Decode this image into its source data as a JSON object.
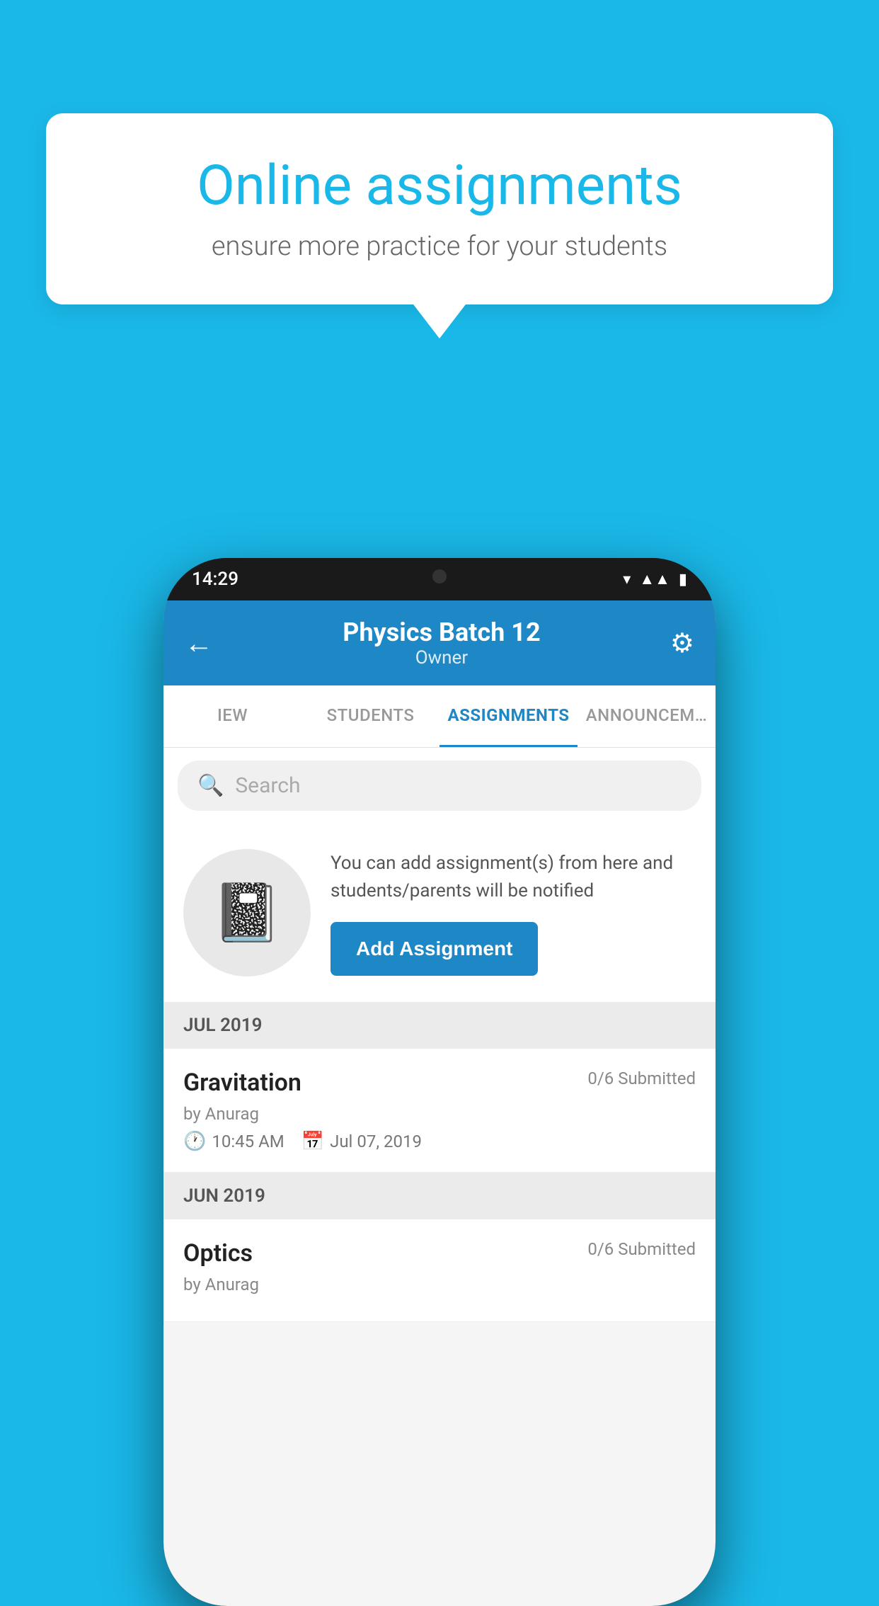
{
  "background_color": "#1ab8e8",
  "speech_bubble": {
    "title": "Online assignments",
    "subtitle": "ensure more practice for your students"
  },
  "status_bar": {
    "time": "14:29",
    "icons": [
      "wifi",
      "signal",
      "battery"
    ]
  },
  "header": {
    "back_label": "←",
    "title": "Physics Batch 12",
    "subtitle": "Owner",
    "settings_label": "⚙"
  },
  "tabs": [
    {
      "label": "IEW",
      "active": false
    },
    {
      "label": "STUDENTS",
      "active": false
    },
    {
      "label": "ASSIGNMENTS",
      "active": true
    },
    {
      "label": "ANNOUNCEM…",
      "active": false
    }
  ],
  "search": {
    "placeholder": "Search"
  },
  "assignment_prompt": {
    "description": "You can add assignment(s) from here and students/parents will be notified",
    "button_label": "Add Assignment"
  },
  "sections": [
    {
      "header": "JUL 2019",
      "items": [
        {
          "name": "Gravitation",
          "submitted": "0/6 Submitted",
          "author": "by Anurag",
          "time": "10:45 AM",
          "date": "Jul 07, 2019"
        }
      ]
    },
    {
      "header": "JUN 2019",
      "items": [
        {
          "name": "Optics",
          "submitted": "0/6 Submitted",
          "author": "by Anurag",
          "time": "",
          "date": ""
        }
      ]
    }
  ]
}
